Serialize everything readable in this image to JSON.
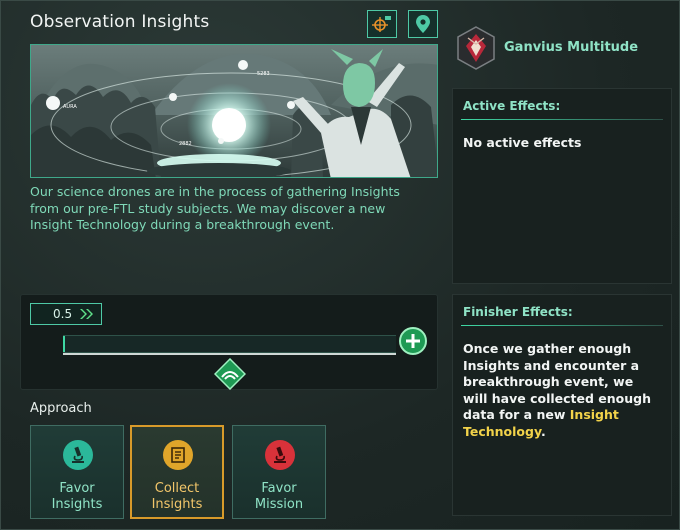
{
  "window": {
    "title": "Observation Insights"
  },
  "header_buttons": [
    {
      "icon": "target-camera-icon"
    },
    {
      "icon": "map-pin-icon"
    }
  ],
  "illustration": {
    "planet_labels": [
      "5283",
      "AURA",
      "2882"
    ]
  },
  "description": "Our science drones are in the process of gathering Insights from our pre-FTL study subjects. We may discover a new Insight Technology during a breakthrough event.",
  "progress": {
    "rate": "0.5",
    "fill_fraction": 0.005
  },
  "approach": {
    "label": "Approach",
    "options": [
      {
        "label_line1": "Favor",
        "label_line2": "Insights",
        "icon": "microscope-icon",
        "color": "#2bb89a",
        "selected": false
      },
      {
        "label_line1": "Collect",
        "label_line2": "Insights",
        "icon": "document-icon",
        "color": "#e0a52a",
        "selected": true
      },
      {
        "label_line1": "Favor",
        "label_line2": "Mission",
        "icon": "microscope-icon",
        "color": "#d8323a",
        "selected": false
      }
    ]
  },
  "empire": {
    "name": "Ganvius Multitude"
  },
  "active_effects": {
    "heading": "Active Effects:",
    "body": "No active effects"
  },
  "finisher_effects": {
    "heading": "Finisher Effects:",
    "body_prefix": "Once we gather enough Insights and encounter a breakthrough event, we will have collected enough data for a new ",
    "highlight": "Insight Technology",
    "body_suffix": "."
  },
  "colors": {
    "accent": "#4ec9a6",
    "text_green": "#7fd9b8",
    "selected_gold": "#d89a2a",
    "highlight_yellow": "#f2d34a"
  }
}
